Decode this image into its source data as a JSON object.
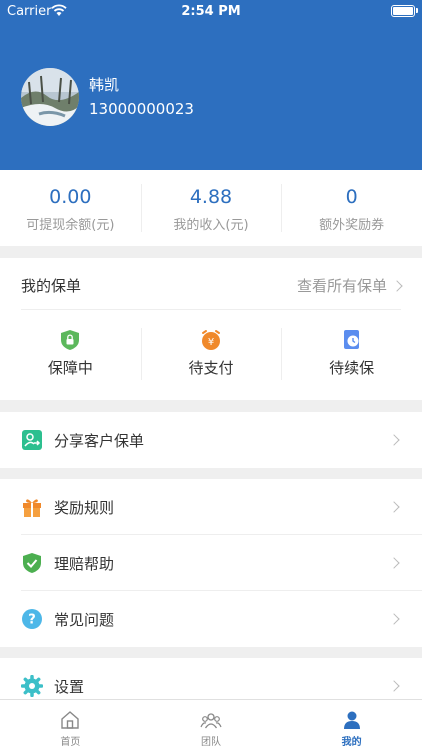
{
  "status_bar": {
    "carrier": "Carrier",
    "time": "2:54 PM"
  },
  "profile": {
    "name": "韩凯",
    "phone": "13000000023"
  },
  "stats": [
    {
      "value": "0.00",
      "label": "可提现余额(元)"
    },
    {
      "value": "4.88",
      "label": "我的收入(元)"
    },
    {
      "value": "0",
      "label": "额外奖励券"
    }
  ],
  "policy": {
    "title": "我的保单",
    "view_all": "查看所有保单",
    "items": [
      {
        "label": "保障中",
        "icon": "shield-lock-icon",
        "color": "#5cb85c"
      },
      {
        "label": "待支付",
        "icon": "yen-clock-icon",
        "color": "#f0892b"
      },
      {
        "label": "待续保",
        "icon": "document-clock-icon",
        "color": "#5b8def"
      }
    ]
  },
  "share": {
    "label": "分享客户保单",
    "icon": "share-user-icon",
    "color": "#2cbf8f"
  },
  "menu": [
    {
      "label": "奖励规则",
      "icon": "gift-icon",
      "color": "#f0892b"
    },
    {
      "label": "理赔帮助",
      "icon": "shield-check-icon",
      "color": "#4caf50"
    },
    {
      "label": "常见问题",
      "icon": "question-icon",
      "color": "#4db7e8"
    }
  ],
  "settings": {
    "label": "设置",
    "icon": "gear-icon",
    "color": "#3cbfc8"
  },
  "tabs": [
    {
      "label": "首页",
      "icon": "home-icon"
    },
    {
      "label": "团队",
      "icon": "team-icon"
    },
    {
      "label": "我的",
      "icon": "person-icon",
      "active": true
    }
  ],
  "colors": {
    "brand": "#2d6fbf",
    "background": "#efefef"
  }
}
